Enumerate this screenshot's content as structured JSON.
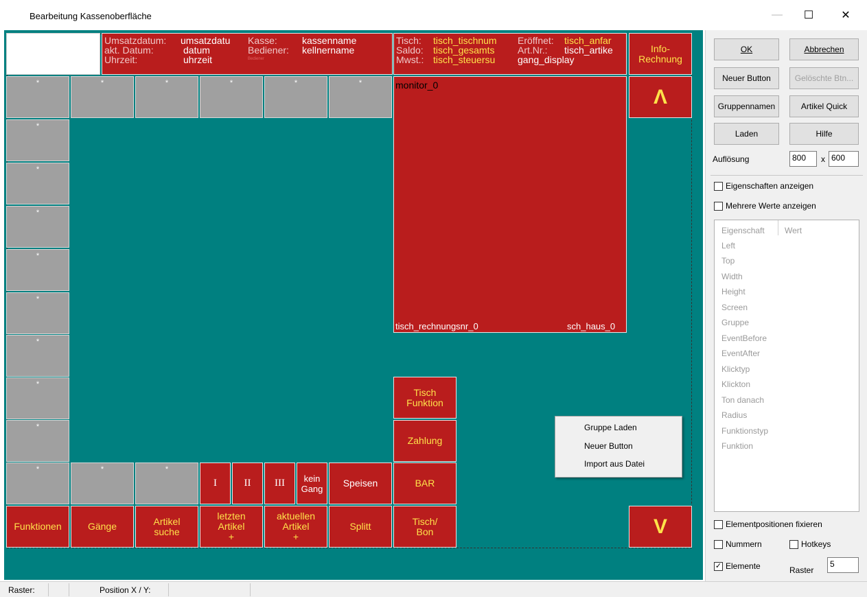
{
  "window": {
    "title": "Bearbeitung Kassenoberfläche",
    "minimize_glyph": "—",
    "maximize_glyph": "☐",
    "close_glyph": "✕"
  },
  "header_info": {
    "umsatzdatum_label": "Umsatzdatum:",
    "umsatzdatum_value": "umsatzdatu",
    "akt_datum_label": "akt. Datum:",
    "akt_datum_value": "datum",
    "uhrzeit_label": "Uhrzeit:",
    "uhrzeit_value": "uhrzeit",
    "kasse_label": "Kasse:",
    "kasse_value": "kassenname",
    "bediener_label": "Bediener:",
    "bediener_value": "kellnername",
    "bediener_small": "Bediener"
  },
  "tisch_info": {
    "tisch_label": "Tisch:",
    "tisch_value": "tisch_tischnum",
    "saldo_label": "Saldo:",
    "saldo_value": "tisch_gesamts",
    "mwst_label": "Mwst.:",
    "mwst_value": "tisch_steuersu",
    "eroeffnet_label": "Eröffnet:",
    "eroeffnet_value": "tisch_anfar",
    "artnr_label": "Art.Nr.:",
    "artnr_value": "tisch_artike",
    "gang_display": "gang_display"
  },
  "info_rechnung": "Info-\nRechnung",
  "monitor": {
    "name": "monitor_0",
    "rechnungsnr": "tisch_rechnungsnr_0",
    "haus": "sch_haus_0"
  },
  "placeholder": "*",
  "scroll_up": "Λ",
  "scroll_down": "V",
  "gang_buttons": [
    "I",
    "II",
    "III"
  ],
  "kein_gang": "kein\nGang",
  "speisen": "Speisen",
  "bar": "BAR",
  "tisch_funktion": "Tisch\nFunktion",
  "zahlung": "Zahlung",
  "bottom_row": {
    "funktionen": "Funktionen",
    "gaenge": "Gänge",
    "artikel_suche": "Artikel\nsuche",
    "letzten_artikel": "letzten\nArtikel\n+",
    "aktuellen_artikel": "aktuellen\nArtikel\n+",
    "splitt": "Splitt",
    "tisch_bon": "Tisch/\nBon"
  },
  "context_menu": [
    "Gruppe Laden",
    "Neuer Button",
    "Import aus Datei"
  ],
  "panel": {
    "ok": "OK",
    "abbrechen": "Abbrechen",
    "neuer_button": "Neuer Button",
    "geloeschte_btn": "Gelöschte Btn...",
    "gruppennamen": "Gruppennamen",
    "artikel_quick": "Artikel Quick",
    "laden": "Laden",
    "hilfe": "Hilfe",
    "aufloesung_label": "Auflösung",
    "aufloesung_w": "800",
    "aufloesung_x": "x",
    "aufloesung_h": "600",
    "eigenschaften_anzeigen": "Eigenschaften anzeigen",
    "mehrere_werte": "Mehrere Werte anzeigen",
    "col_eigenschaft": "Eigenschaft",
    "col_wert": "Wert",
    "properties": [
      "Left",
      "Top",
      "Width",
      "Height",
      "Screen",
      "Gruppe",
      "EventBefore",
      "EventAfter",
      "Klicktyp",
      "Klickton",
      "Ton danach",
      "Radius",
      "Funktionstyp",
      "Funktion"
    ],
    "elementpositionen": "Elementpositionen fixieren",
    "nummern": "Nummern",
    "hotkeys": "Hotkeys",
    "elemente": "Elemente",
    "elemente_checked": "✓",
    "raster_label": "Raster",
    "raster_value": "5"
  },
  "statusbar": {
    "raster": "Raster:",
    "position": "Position X / Y:"
  }
}
